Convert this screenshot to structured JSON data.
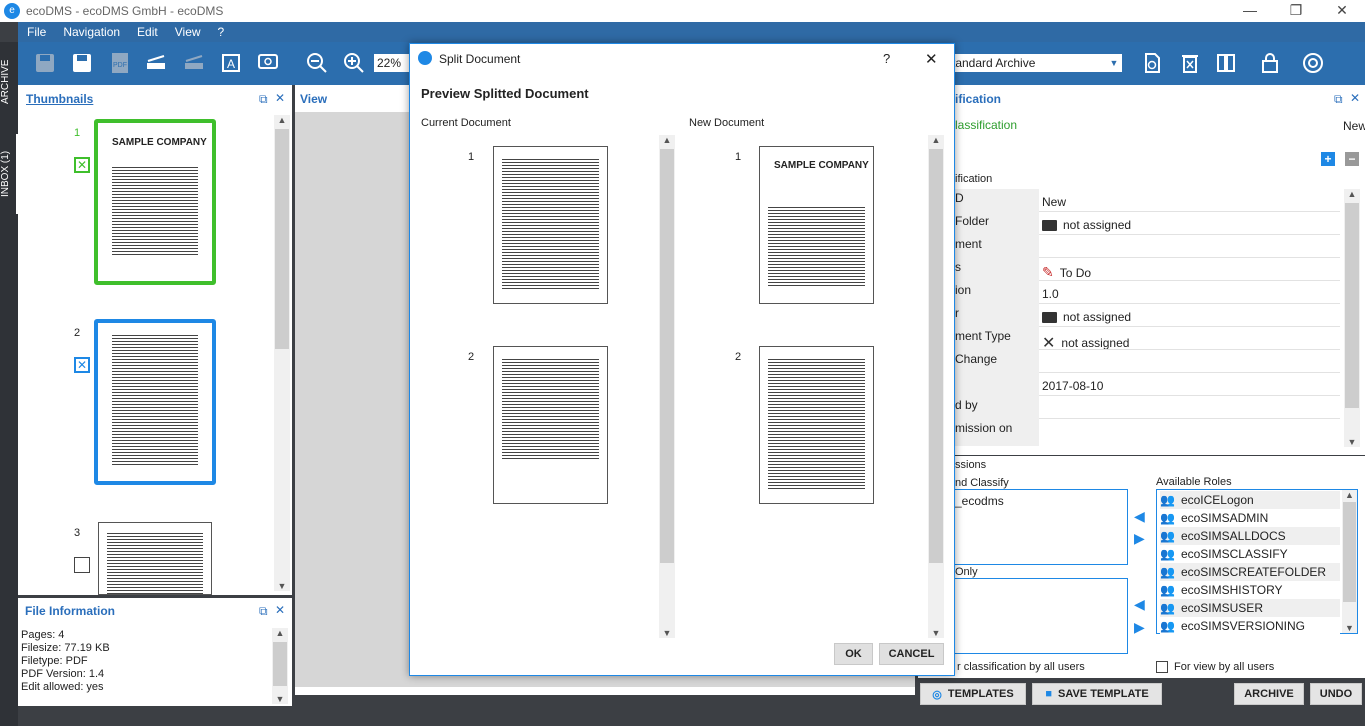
{
  "window": {
    "title": "ecoDMS - ecoDMS GmbH - ecoDMS",
    "min": "—",
    "max": "❐",
    "close": "✕"
  },
  "menu": [
    "File",
    "Navigation",
    "Edit",
    "View",
    "?"
  ],
  "toolbar": {
    "zoom": "22%",
    "archive_select": "Standard Archive"
  },
  "side_tabs": {
    "archive": "ARCHIVE",
    "inbox": "INBOX (1)"
  },
  "thumbnails": {
    "title": "Thumbnails",
    "pages": [
      {
        "num": "1",
        "heading": "SAMPLE COMPANY"
      },
      {
        "num": "2"
      },
      {
        "num": "3"
      }
    ]
  },
  "view": {
    "title": "View"
  },
  "file_info": {
    "title": "File Information",
    "lines": [
      "Pages: 4",
      "Filesize: 77.19 KB",
      "Filetype: PDF",
      "PDF Version: 1.4",
      "Edit allowed: yes"
    ]
  },
  "dialog": {
    "title": "Split Document",
    "help": "?",
    "close": "✕",
    "heading": "Preview Splitted Document",
    "current_label": "Current Document",
    "new_label": "New Document",
    "current_pages": [
      "1",
      "2"
    ],
    "new_pages": [
      {
        "num": "1",
        "heading": "SAMPLE COMPANY"
      },
      {
        "num": "2"
      }
    ],
    "ok": "OK",
    "cancel": "CANCEL"
  },
  "classification": {
    "title": "ification",
    "sub": "lassification",
    "status_right": "New",
    "group": "ification",
    "rows": [
      {
        "label": "D",
        "value": "New",
        "icon": ""
      },
      {
        "label": "Folder",
        "value": "not assigned",
        "icon": "folder-icon"
      },
      {
        "label": "ment",
        "value": "",
        "icon": ""
      },
      {
        "label": "s",
        "value": "To Do",
        "icon": "pencil-icon"
      },
      {
        "label": "ion",
        "value": "1.0",
        "icon": ""
      },
      {
        "label": "r",
        "value": "not assigned",
        "icon": "folder-icon"
      },
      {
        "label": "ment Type",
        "value": "not assigned",
        "icon": "cross-icon"
      },
      {
        "label": "Change",
        "value": "",
        "icon": ""
      },
      {
        "label": "",
        "value": "2017-08-10",
        "icon": ""
      },
      {
        "label": "d by",
        "value": "",
        "icon": ""
      },
      {
        "label": "mission on",
        "value": "",
        "icon": ""
      }
    ]
  },
  "permissions": {
    "title": "ssions",
    "edit_label": "nd Classify",
    "edit_item": "_ecodms",
    "read_label": "Only",
    "available_label": "Available Roles",
    "roles": [
      "ecoICELogon",
      "ecoSIMSADMIN",
      "ecoSIMSALLDOCS",
      "ecoSIMSCLASSIFY",
      "ecoSIMSCREATEFOLDER",
      "ecoSIMSHISTORY",
      "ecoSIMSUSER",
      "ecoSIMSVERSIONING"
    ],
    "classify_all": "r classification by all users",
    "view_all": "For view by all users"
  },
  "bottom": {
    "templates": "TEMPLATES",
    "save_template": "SAVE TEMPLATE",
    "archive": "ARCHIVE",
    "undo": "UNDO"
  },
  "colors": {
    "accent": "#2c6eae",
    "green": "#3fbf2c",
    "blue": "#1e88e5"
  }
}
